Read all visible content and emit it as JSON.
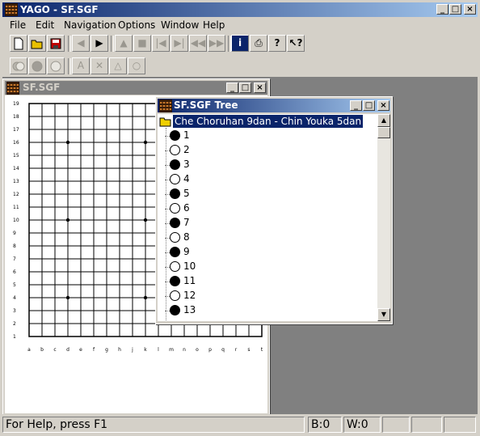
{
  "app": {
    "title": "YAGO - SF.SGF"
  },
  "menu": [
    "File",
    "Edit",
    "Navigation",
    "Options",
    "Window",
    "Help"
  ],
  "board_window": {
    "title": "SF.SGF"
  },
  "board": {
    "size": 19,
    "row_labels": [
      "19",
      "18",
      "17",
      "16",
      "15",
      "14",
      "13",
      "12",
      "11",
      "10",
      "9",
      "8",
      "7",
      "6",
      "5",
      "4",
      "3",
      "2",
      "1"
    ],
    "col_labels": [
      "a",
      "b",
      "c",
      "d",
      "e",
      "f",
      "g",
      "h",
      "j",
      "k",
      "l",
      "m",
      "n",
      "o",
      "p",
      "q",
      "r",
      "s",
      "t"
    ]
  },
  "tree_window": {
    "title": "SF.SGF Tree",
    "game": "Che Choruhan 9dan - Chin Youka 5dan",
    "moves": [
      {
        "n": "1",
        "c": "b"
      },
      {
        "n": "2",
        "c": "w"
      },
      {
        "n": "3",
        "c": "b"
      },
      {
        "n": "4",
        "c": "w"
      },
      {
        "n": "5",
        "c": "b"
      },
      {
        "n": "6",
        "c": "w"
      },
      {
        "n": "7",
        "c": "b"
      },
      {
        "n": "8",
        "c": "w"
      },
      {
        "n": "9",
        "c": "b"
      },
      {
        "n": "10",
        "c": "w"
      },
      {
        "n": "11",
        "c": "b"
      },
      {
        "n": "12",
        "c": "w"
      },
      {
        "n": "13",
        "c": "b"
      }
    ]
  },
  "status": {
    "help": "For Help, press F1",
    "black": "B:0",
    "white": "W:0"
  },
  "colors": {
    "titlebar_active": "#0a246a",
    "titlebar_inactive": "#808080",
    "selection": "#0a246a"
  }
}
